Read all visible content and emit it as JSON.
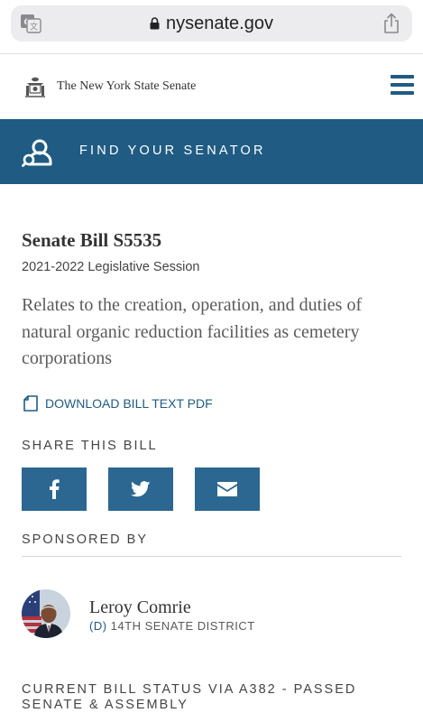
{
  "browser": {
    "url": "nysenate.gov",
    "icons": {
      "translate": "translate-icon",
      "lock": "lock-icon",
      "share": "share-icon"
    }
  },
  "header": {
    "site_name": "The New York State Senate",
    "icons": {
      "seal": "nys-seal-icon",
      "menu": "hamburger-menu-icon"
    }
  },
  "find_senator": {
    "label": "FIND YOUR SENATOR",
    "icon": "find-senator-icon"
  },
  "bill": {
    "title": "Senate Bill S5535",
    "session": "2021-2022 Legislative Session",
    "summary": "Relates to the creation, operation, and duties of natural organic reduction facilities as cemetery corporations",
    "download_label": "DOWNLOAD BILL TEXT PDF"
  },
  "share": {
    "heading": "SHARE THIS BILL",
    "buttons": [
      {
        "name": "facebook",
        "icon": "facebook-icon"
      },
      {
        "name": "twitter",
        "icon": "twitter-icon"
      },
      {
        "name": "email",
        "icon": "email-icon"
      }
    ]
  },
  "sponsor": {
    "heading": "SPONSORED BY",
    "name": "Leroy Comrie",
    "party": "(D)",
    "district": "14TH SENATE DISTRICT"
  },
  "status": {
    "heading": "CURRENT BILL STATUS VIA A382 - PASSED SENATE & ASSEMBLY"
  },
  "colors": {
    "brand_blue": "#1f5b82",
    "share_button": "#2b6790",
    "url_bar": "#ececee"
  }
}
